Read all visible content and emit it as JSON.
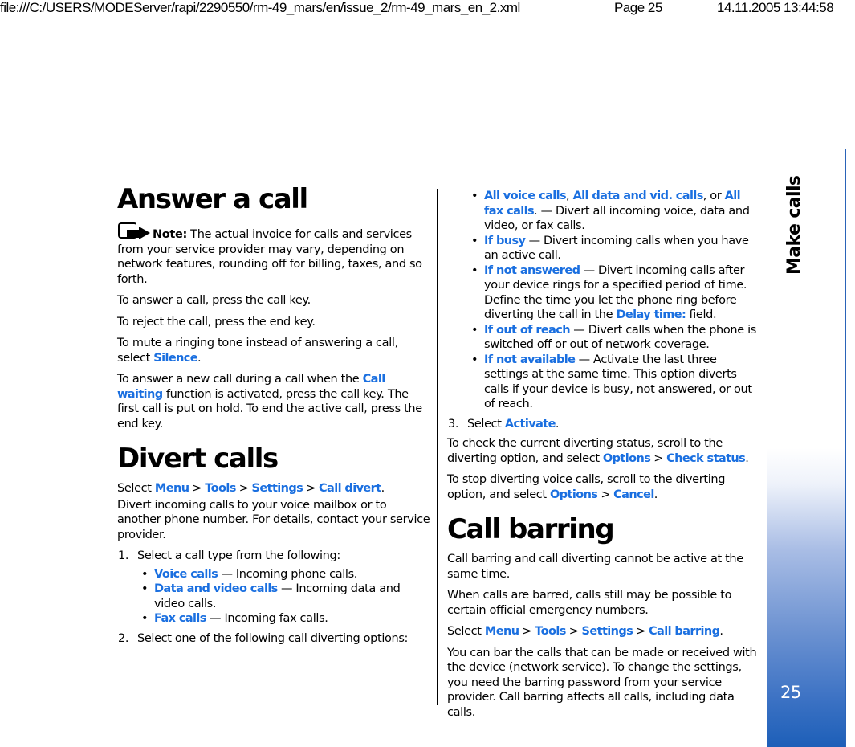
{
  "header": {
    "path": "file:///C:/USERS/MODEServer/rapi/2290550/rm-49_mars/en/issue_2/rm-49_mars_en_2.xml",
    "page": "Page 25",
    "datetime": "14.11.2005 13:44:58"
  },
  "side_tab": {
    "title": "Make calls",
    "page_number": "25"
  },
  "sections": {
    "answer": {
      "title": "Answer a call",
      "note_label": "Note:",
      "note_text": " The actual invoice for calls and services from your service provider may vary, depending on network features, rounding off for billing, taxes, and so forth.",
      "p1": "To answer a call, press the call key.",
      "p2": "To reject the call, press the end key.",
      "p3_pre": "To mute a ringing tone instead of answering a call, select ",
      "p3_link": "Silence",
      "p3_post": ".",
      "p4_pre": "To answer a new call during a call when the ",
      "p4_link": "Call waiting",
      "p4_post": " function is activated, press the call key. The first call is put on hold. To end the active call, press the end key."
    },
    "divert": {
      "title": "Divert calls",
      "select_word": "Select ",
      "path": [
        "Menu",
        "Tools",
        "Settings",
        "Call divert"
      ],
      "separator": ">",
      "period": ".",
      "intro": "Divert incoming calls to your voice mailbox or to another phone number. For details, contact your service provider.",
      "step1_num": "1.",
      "step1_text": "Select a call type from the following:",
      "call_types": [
        {
          "link": "Voice calls",
          "desc": " — Incoming phone calls."
        },
        {
          "link": "Data and video calls",
          "desc": " — Incoming data and video calls."
        },
        {
          "link": "Fax calls",
          "desc": " — Incoming fax calls."
        }
      ],
      "step2_num": "2.",
      "step2_text": "Select one of the following call diverting options:",
      "options": {
        "all_link1": "All voice calls",
        "all_sep1": ", ",
        "all_link2": "All data and vid. calls",
        "all_sep2": ", or ",
        "all_link3": "All fax calls",
        "all_desc": ". — Divert all incoming voice, data and video, or fax calls.",
        "busy_link": "If busy",
        "busy_desc": " — Divert incoming calls when you have an active call.",
        "noans_link": "If not answered",
        "noans_desc1": " — Divert incoming calls after your device rings for a specified period of time. Define the time you let the phone ring before diverting the call in the ",
        "noans_field": "Delay time:",
        "noans_desc2": " field.",
        "reach_link": "If out of reach",
        "reach_desc": " — Divert calls when the phone is switched off or out of network coverage.",
        "avail_link": "If not available",
        "avail_desc": " — Activate the last three settings at the same time. This option diverts calls if your device is busy, not answered, or out of reach."
      },
      "step3_num": "3.",
      "step3_pre": "Select ",
      "step3_link": "Activate",
      "step3_post": ".",
      "check_pre": "To check the current diverting status, scroll to the diverting option, and select ",
      "check_link1": "Options",
      "check_link2": "Check status",
      "stop_pre": "To stop diverting voice calls, scroll to the diverting option, and select ",
      "stop_link1": "Options",
      "stop_link2": "Cancel"
    },
    "barring": {
      "title": "Call barring",
      "p1": "Call barring and call diverting cannot be active at the same time.",
      "p2": "When calls are barred, calls still may be possible to certain official emergency numbers.",
      "select_word": "Select ",
      "path": [
        "Menu",
        "Tools",
        "Settings",
        "Call barring"
      ],
      "p4": "You can bar the calls that can be made or received with the device (network service). To change the settings, you need the barring password from your service provider. Call barring affects all calls, including data calls."
    }
  },
  "colors": {
    "link": "#1a6fe0",
    "tab_blue": "#1d5fb8"
  }
}
